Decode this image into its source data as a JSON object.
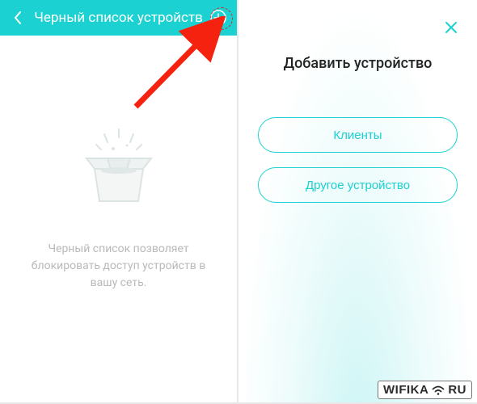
{
  "left": {
    "title": "Черный список устройств",
    "empty_caption": "Черный список позволяет блокировать доступ устройств в вашу сеть."
  },
  "right": {
    "title": "Добавить устройство",
    "options": {
      "clients": "Клиенты",
      "other": "Другое устройство"
    }
  },
  "watermark": {
    "text_left": "WIFIKA",
    "text_right": "RU"
  },
  "colors": {
    "accent": "#1bd1d1",
    "arrow": "#f4220f"
  }
}
